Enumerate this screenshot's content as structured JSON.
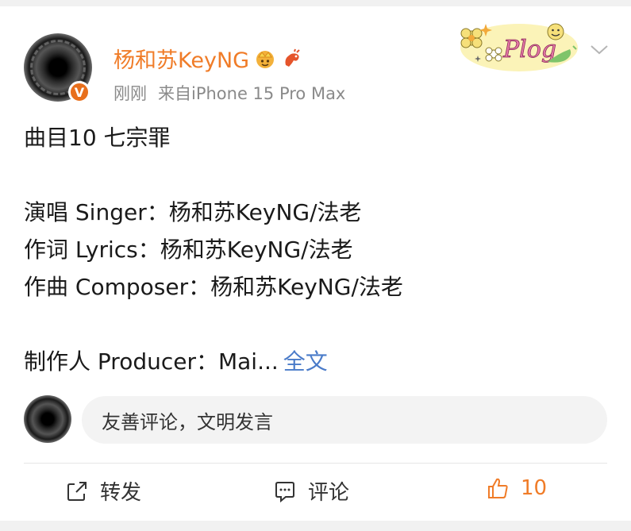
{
  "post": {
    "author": {
      "name": "杨和苏KeyNG",
      "verified_icon": "v-badge-icon"
    },
    "time": "刚刚",
    "source": "来自iPhone 15 Pro Max",
    "sticker_text": "Plog",
    "lines": [
      "曲目10 七宗罪",
      "",
      "演唱 Singer：杨和苏KeyNG/法老",
      "作词 Lyrics：杨和苏KeyNG/法老",
      "作曲 Composer：杨和苏KeyNG/法老",
      "",
      "制作人 Producer：Mai..."
    ],
    "expand_label": "全文"
  },
  "comment": {
    "placeholder": "友善评论，文明发言"
  },
  "actions": {
    "repost_label": "转发",
    "comment_label": "评论",
    "like_count": "10"
  },
  "colors": {
    "accent": "#f07c28",
    "link": "#4a7bc9"
  }
}
